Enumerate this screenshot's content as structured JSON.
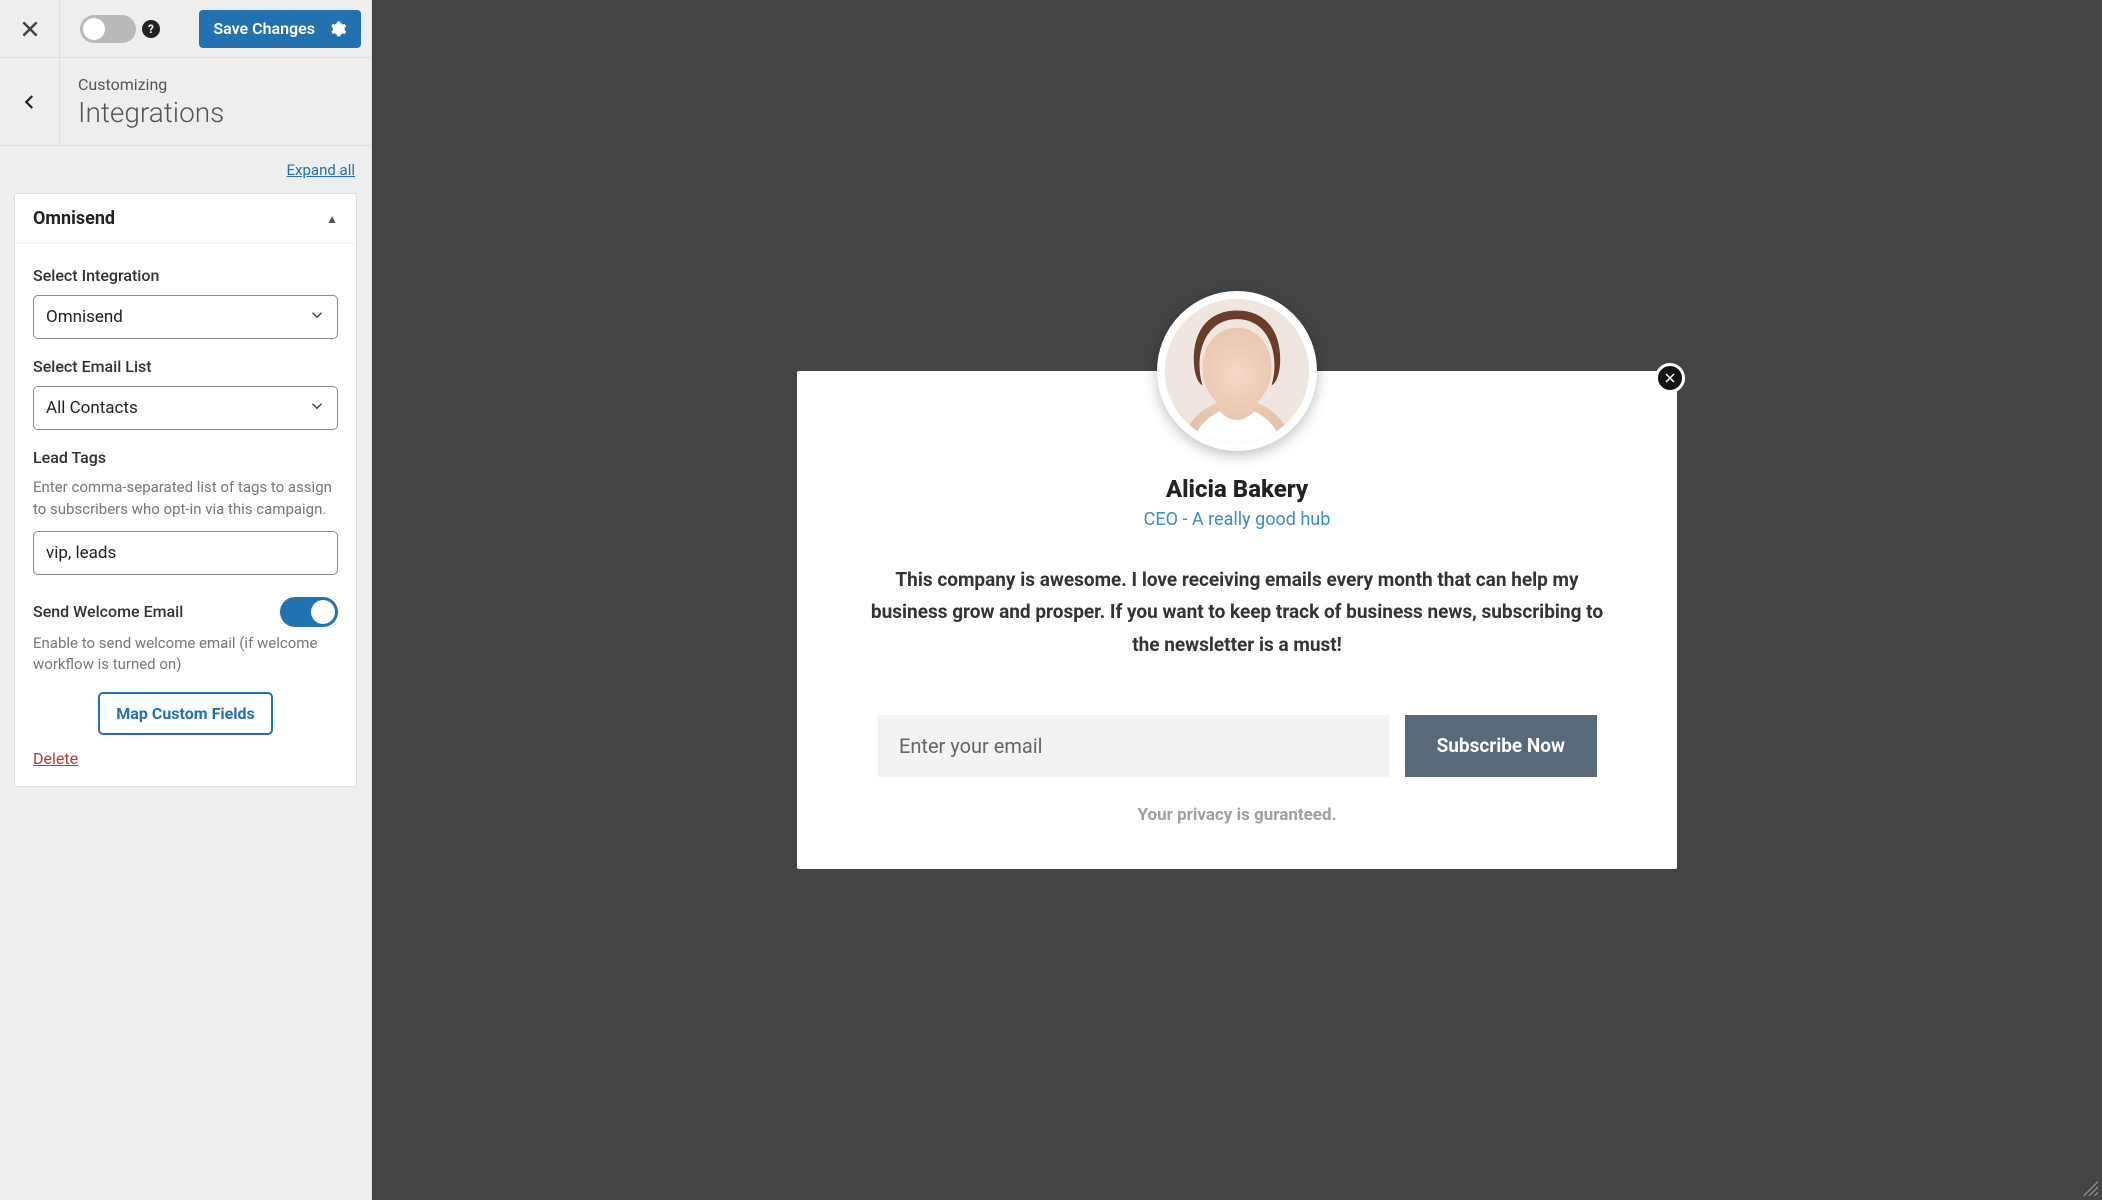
{
  "topbar": {
    "save_label": "Save Changes"
  },
  "header": {
    "crumb": "Customizing",
    "title": "Integrations"
  },
  "expand_all": "Expand all",
  "panel": {
    "title": "Omnisend",
    "select_integration_label": "Select Integration",
    "select_integration_value": "Omnisend",
    "select_list_label": "Select Email List",
    "select_list_value": "All Contacts",
    "lead_tags_label": "Lead Tags",
    "lead_tags_desc": "Enter comma-separated list of tags to assign to subscribers who opt-in via this campaign.",
    "lead_tags_value": "vip, leads",
    "welcome_label": "Send Welcome Email",
    "welcome_desc": "Enable to send welcome email (if welcome workflow is turned on)",
    "map_btn": "Map Custom Fields",
    "delete": "Delete"
  },
  "popup": {
    "name": "Alicia Bakery",
    "role": "CEO - A really good hub",
    "quote": "This company is awesome. I love receiving emails every month that can help my business grow and prosper. If you want to keep track of business news, subscribing to the newsletter is a must!",
    "email_placeholder": "Enter your email",
    "subscribe": "Subscribe Now",
    "privacy": "Your privacy is guranteed."
  }
}
